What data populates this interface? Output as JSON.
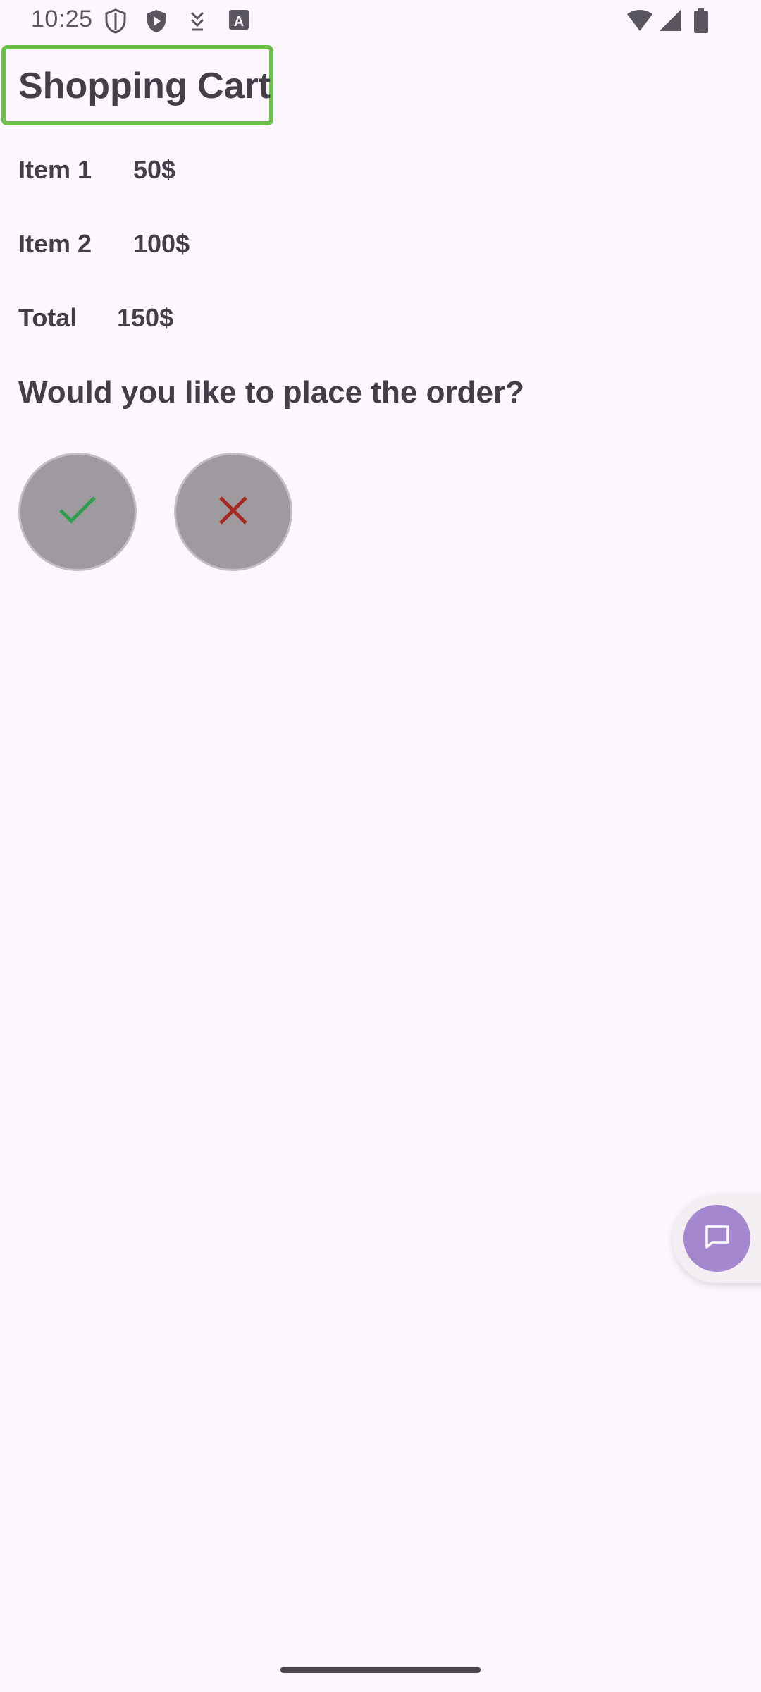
{
  "status_bar": {
    "time": "10:25",
    "icons": [
      "shield-outline-icon",
      "play-shield-icon",
      "download-arrow-icon",
      "font-a-icon",
      "wifi-icon",
      "cell-signal-icon",
      "battery-icon"
    ]
  },
  "header": {
    "title": "Shopping Cart"
  },
  "cart": {
    "items": [
      {
        "label": "Item 1",
        "price": "50$"
      },
      {
        "label": "Item 2",
        "price": "100$"
      }
    ],
    "total": {
      "label": "Total",
      "price": "150$"
    }
  },
  "prompt": {
    "question": "Would you like to place the order?"
  },
  "actions": {
    "confirm_icon": "check-icon",
    "cancel_icon": "close-icon",
    "confirm_color": "#2e9e4f",
    "cancel_color": "#a8281e"
  },
  "fab": {
    "icon": "chat-icon",
    "color": "#a487cf"
  }
}
